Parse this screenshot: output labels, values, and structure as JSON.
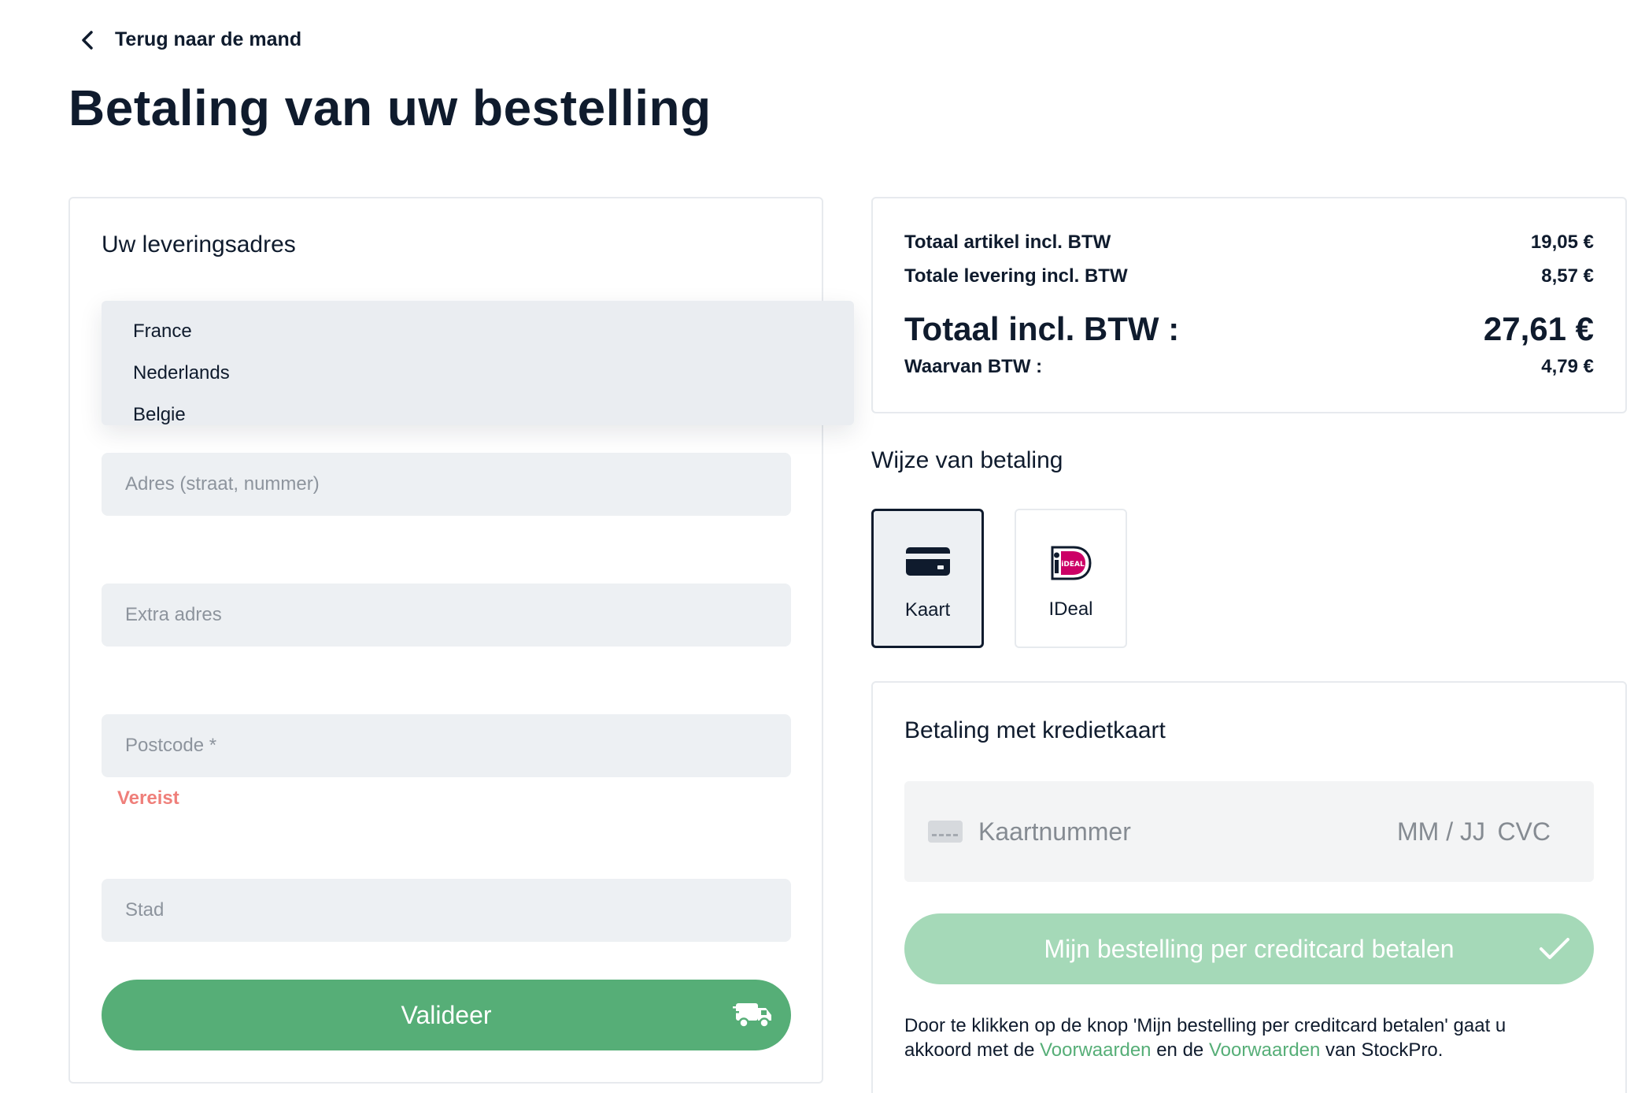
{
  "nav": {
    "back_label": "Terug naar de mand"
  },
  "page": {
    "title": "Betaling van uw bestelling"
  },
  "address": {
    "title": "Uw leveringsadres",
    "country_options": [
      "France",
      "Nederlands",
      "Belgie"
    ],
    "adres_placeholder": "Adres (straat, nummer)",
    "extra_placeholder": "Extra adres",
    "postcode_placeholder": "Postcode *",
    "postcode_error": "Vereist",
    "stad_placeholder": "Stad",
    "validate_label": "Valideer",
    "validate_icon": "delivery-truck-icon"
  },
  "totals": {
    "artikel_label": "Totaal artikel incl. BTW",
    "artikel_value": "19,05 €",
    "levering_label": "Totale levering incl. BTW",
    "levering_value": "8,57 €",
    "total_label": "Totaal incl. BTW :",
    "total_value": "27,61 €",
    "btw_label": "Waarvan BTW :",
    "btw_value": "4,79 €"
  },
  "payment": {
    "method_title": "Wijze van betaling",
    "methods": [
      {
        "label": "Kaart",
        "icon": "credit-card-icon",
        "selected": true
      },
      {
        "label": "IDeal",
        "icon": "ideal-logo-icon",
        "selected": false
      }
    ],
    "ideal_logo_text": "iDEAL",
    "card_title": "Betaling met kredietkaart",
    "card_number_placeholder": "Kaartnummer",
    "expiry_placeholder": "MM / JJ",
    "cvc_placeholder": "CVC",
    "pay_button_label": "Mijn bestelling per creditcard betalen",
    "terms_prefix": "Door te klikken op de knop 'Mijn bestelling per creditcard betalen' gaat u akkoord met de ",
    "terms_link_1": "Voorwaarden",
    "terms_middle": " en de ",
    "terms_link_2": "Voorwaarden",
    "terms_suffix": " van StockPro."
  },
  "colors": {
    "primary_green": "#56ae77",
    "disabled_green": "#a5d9b8",
    "error_red": "#ef7f7a",
    "navy": "#0f1b2d",
    "field_bg": "#edf0f3"
  }
}
